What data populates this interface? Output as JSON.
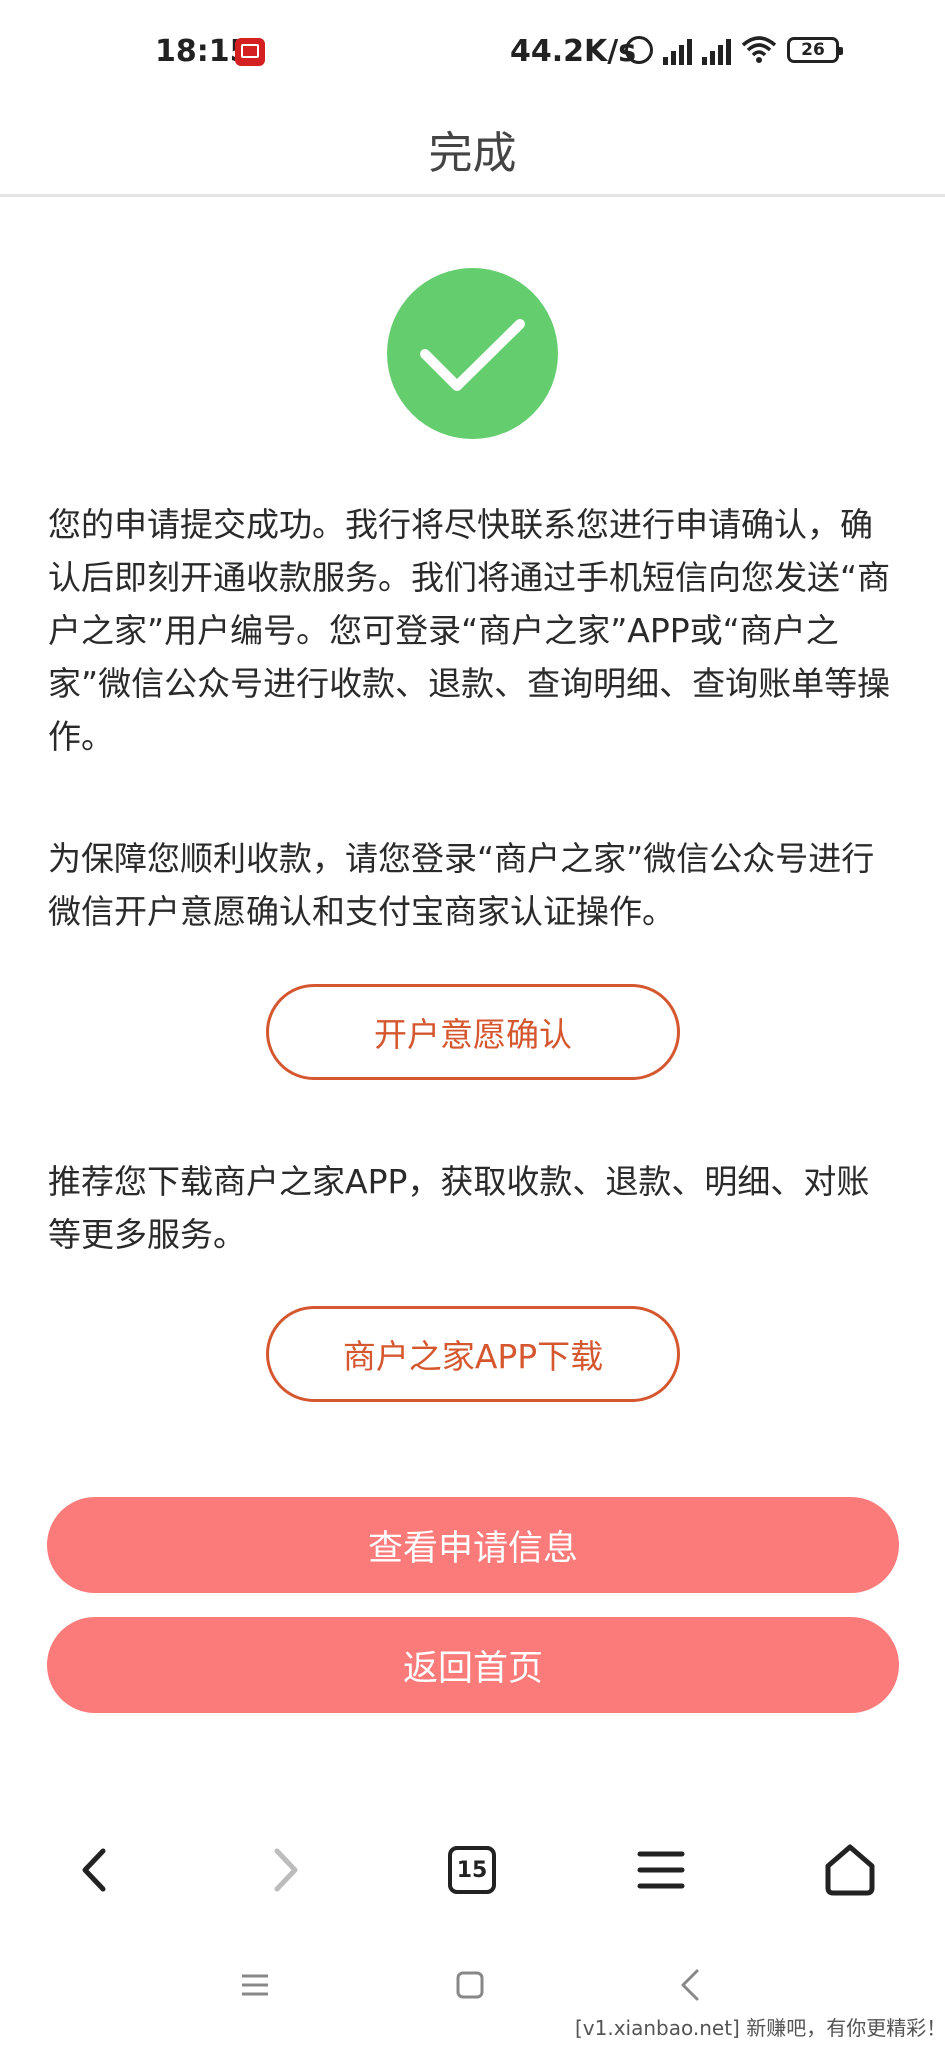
{
  "status_bar": {
    "time": "18:15",
    "network_speed": "44.2K/s",
    "battery": "26",
    "icons": [
      "app-notification-icon",
      "alarm-icon",
      "signal-hd-icon",
      "signal-hd-icon",
      "wifi-icon",
      "battery-icon"
    ]
  },
  "header": {
    "title": "完成"
  },
  "main": {
    "paragraph_1": "您的申请提交成功。我行将尽快联系您进行申请确认，确认后即刻开通收款服务。我们将通过手机短信向您发送“商户之家”用户编号。您可登录“商户之家”APP或“商户之家”微信公众号进行收款、退款、查询明细、查询账单等操作。",
    "paragraph_2": "为保障您顺利收款，请您登录“商户之家”微信公众号进行微信开户意愿确认和支付宝商家认证操作。",
    "confirm_button": "开户意愿确认",
    "paragraph_3": "推荐您下载商户之家APP，获取收款、退款、明细、对账等更多服务。",
    "download_button": "商户之家APP下载",
    "view_application_button": "查看申请信息",
    "return_home_button": "返回首页"
  },
  "browser_nav": {
    "tab_count": "15"
  },
  "watermark": "[v1.xianbao.net] 新赚吧，有你更精彩！",
  "colors": {
    "accent_outline": "#d5572f",
    "primary_button": "#fb7b7b",
    "success_green": "#64cd6e"
  }
}
